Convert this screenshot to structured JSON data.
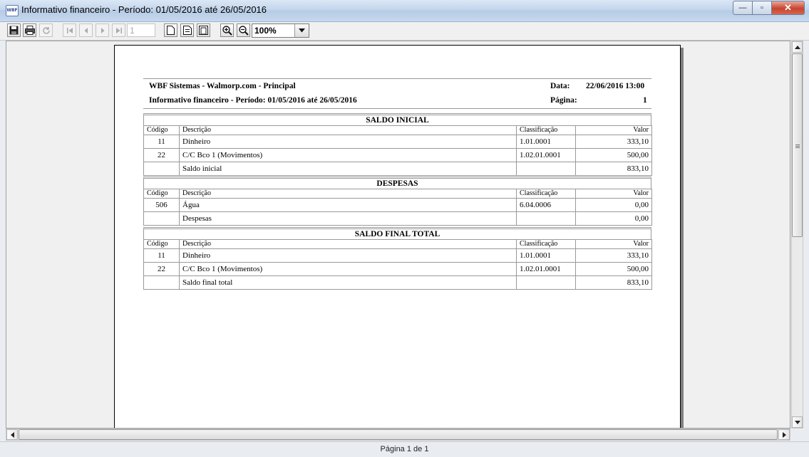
{
  "window": {
    "title": "Informativo financeiro - Período: 01/05/2016 até 26/05/2016",
    "icon_label": "WBF",
    "minimize_glyph": "—",
    "maximize_glyph": "▫",
    "close_glyph": "✕"
  },
  "toolbar": {
    "icons": [
      "save-icon",
      "print-icon",
      "refresh-icon",
      "first-page-icon",
      "prev-page-icon",
      "next-page-icon",
      "last-page-icon",
      "one-page-icon",
      "page-width-icon",
      "full-page-icon",
      "zoom-in-icon",
      "zoom-out-icon"
    ],
    "page_number": "1",
    "zoom": "100%"
  },
  "report": {
    "company": "WBF Sistemas - Walmorp.com - Principal",
    "subtitle": "Informativo financeiro - Período: 01/05/2016 até 26/05/2016",
    "date_label": "Data:",
    "date_value": "22/06/2016 13:00",
    "page_label": "Página:",
    "page_value": "1",
    "columns": {
      "code": "Código",
      "description": "Descrição",
      "classification": "Classificação",
      "value": "Valor"
    },
    "sections": [
      {
        "title": "SALDO INICIAL",
        "rows": [
          {
            "code": "11",
            "description": "Dinheiro",
            "classification": "1.01.0001",
            "value": "333,10"
          },
          {
            "code": "22",
            "description": "C/C Bco 1 (Movimentos)",
            "classification": "1.02.01.0001",
            "value": "500,00"
          }
        ],
        "total": {
          "description": "Saldo inicial",
          "value": "833,10"
        }
      },
      {
        "title": "DESPESAS",
        "rows": [
          {
            "code": "506",
            "description": "Água",
            "classification": "6.04.0006",
            "value": "0,00"
          }
        ],
        "total": {
          "description": "Despesas",
          "value": "0,00"
        }
      },
      {
        "title": "SALDO FINAL TOTAL",
        "rows": [
          {
            "code": "11",
            "description": "Dinheiro",
            "classification": "1.01.0001",
            "value": "333,10"
          },
          {
            "code": "22",
            "description": "C/C Bco 1 (Movimentos)",
            "classification": "1.02.01.0001",
            "value": "500,00"
          }
        ],
        "total": {
          "description": "Saldo final total",
          "value": "833,10"
        }
      }
    ]
  },
  "status": {
    "text": "Página 1 de 1"
  }
}
